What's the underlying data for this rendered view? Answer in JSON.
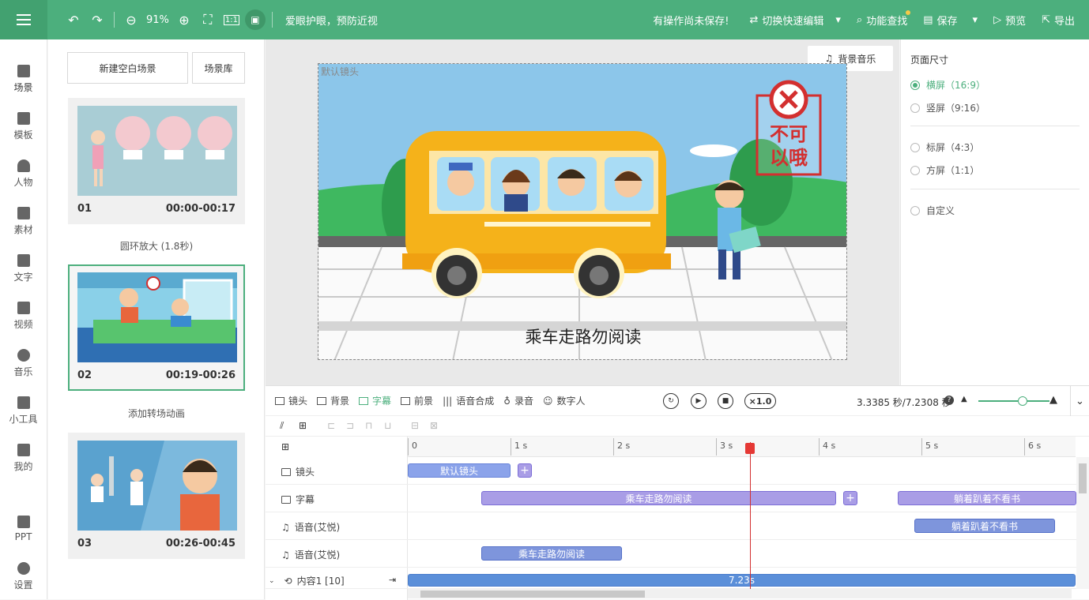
{
  "topbar": {
    "zoom": "91%",
    "eye_care": "爱眼护眼，预防近视",
    "unsaved": "有操作尚未保存!",
    "switch_edit": "切换快速编辑",
    "find": "功能查找",
    "save": "保存",
    "preview": "预览",
    "export": "导出"
  },
  "nav": [
    {
      "label": "场景",
      "icon": "scene-icon"
    },
    {
      "label": "模板",
      "icon": "template-icon"
    },
    {
      "label": "人物",
      "icon": "person-icon"
    },
    {
      "label": "素材",
      "icon": "material-icon"
    },
    {
      "label": "文字",
      "icon": "text-icon"
    },
    {
      "label": "视频",
      "icon": "video-icon"
    },
    {
      "label": "音乐",
      "icon": "music-icon"
    },
    {
      "label": "小工具",
      "icon": "toolbox-icon"
    },
    {
      "label": "我的",
      "icon": "my-icon"
    },
    {
      "label": "PPT",
      "icon": "ppt-icon"
    },
    {
      "label": "设置",
      "icon": "gear-icon"
    }
  ],
  "scenes_panel": {
    "new_blank": "新建空白场景",
    "library": "场景库",
    "scenes": [
      {
        "num": "01",
        "time": "00:00-00:17"
      },
      {
        "num": "02",
        "time": "00:19-00:26"
      },
      {
        "num": "03",
        "time": "00:26-00:45"
      }
    ],
    "transitions": [
      "圆环放大 (1.8秒)",
      "添加转场动画"
    ]
  },
  "canvas": {
    "default_lens": "默认镜头",
    "subtitle": "乘车走路勿阅读",
    "bgm": "背景音乐",
    "sign_text_1": "不可",
    "sign_text_2": "以哦"
  },
  "right_panel": {
    "title": "页面尺寸",
    "options": [
      {
        "label": "横屏（16:9）",
        "selected": true
      },
      {
        "label": "竖屏（9:16）",
        "selected": false
      },
      {
        "label": "标屏（4:3）",
        "selected": false
      },
      {
        "label": "方屏（1:1）",
        "selected": false
      },
      {
        "label": "自定义",
        "selected": false
      }
    ]
  },
  "timeline": {
    "tabs": [
      "镜头",
      "背景",
      "字幕",
      "前景",
      "语音合成",
      "录音",
      "数字人"
    ],
    "active_tab": "字幕",
    "speed": "×1.0",
    "time_display": "3.3385 秒/7.2308 秒",
    "ruler": [
      "0",
      "1 s",
      "2 s",
      "3 s",
      "4 s",
      "5 s",
      "6 s"
    ],
    "tracks": [
      {
        "label": "镜头",
        "clips": [
          "默认镜头"
        ]
      },
      {
        "label": "字幕",
        "clips": [
          "乘车走路勿阅读",
          "躺着趴着不看书"
        ]
      },
      {
        "label": "语音(艾悦)",
        "clips": [
          "躺着趴着不看书"
        ]
      },
      {
        "label": "语音(艾悦)",
        "clips": [
          "乘车走路勿阅读"
        ]
      },
      {
        "label": "内容1 [10]",
        "clips": [
          "7.23s"
        ]
      }
    ]
  },
  "colors": {
    "brand": "#4caf7d",
    "clip": "#a99de6",
    "playhead": "#e53935"
  }
}
